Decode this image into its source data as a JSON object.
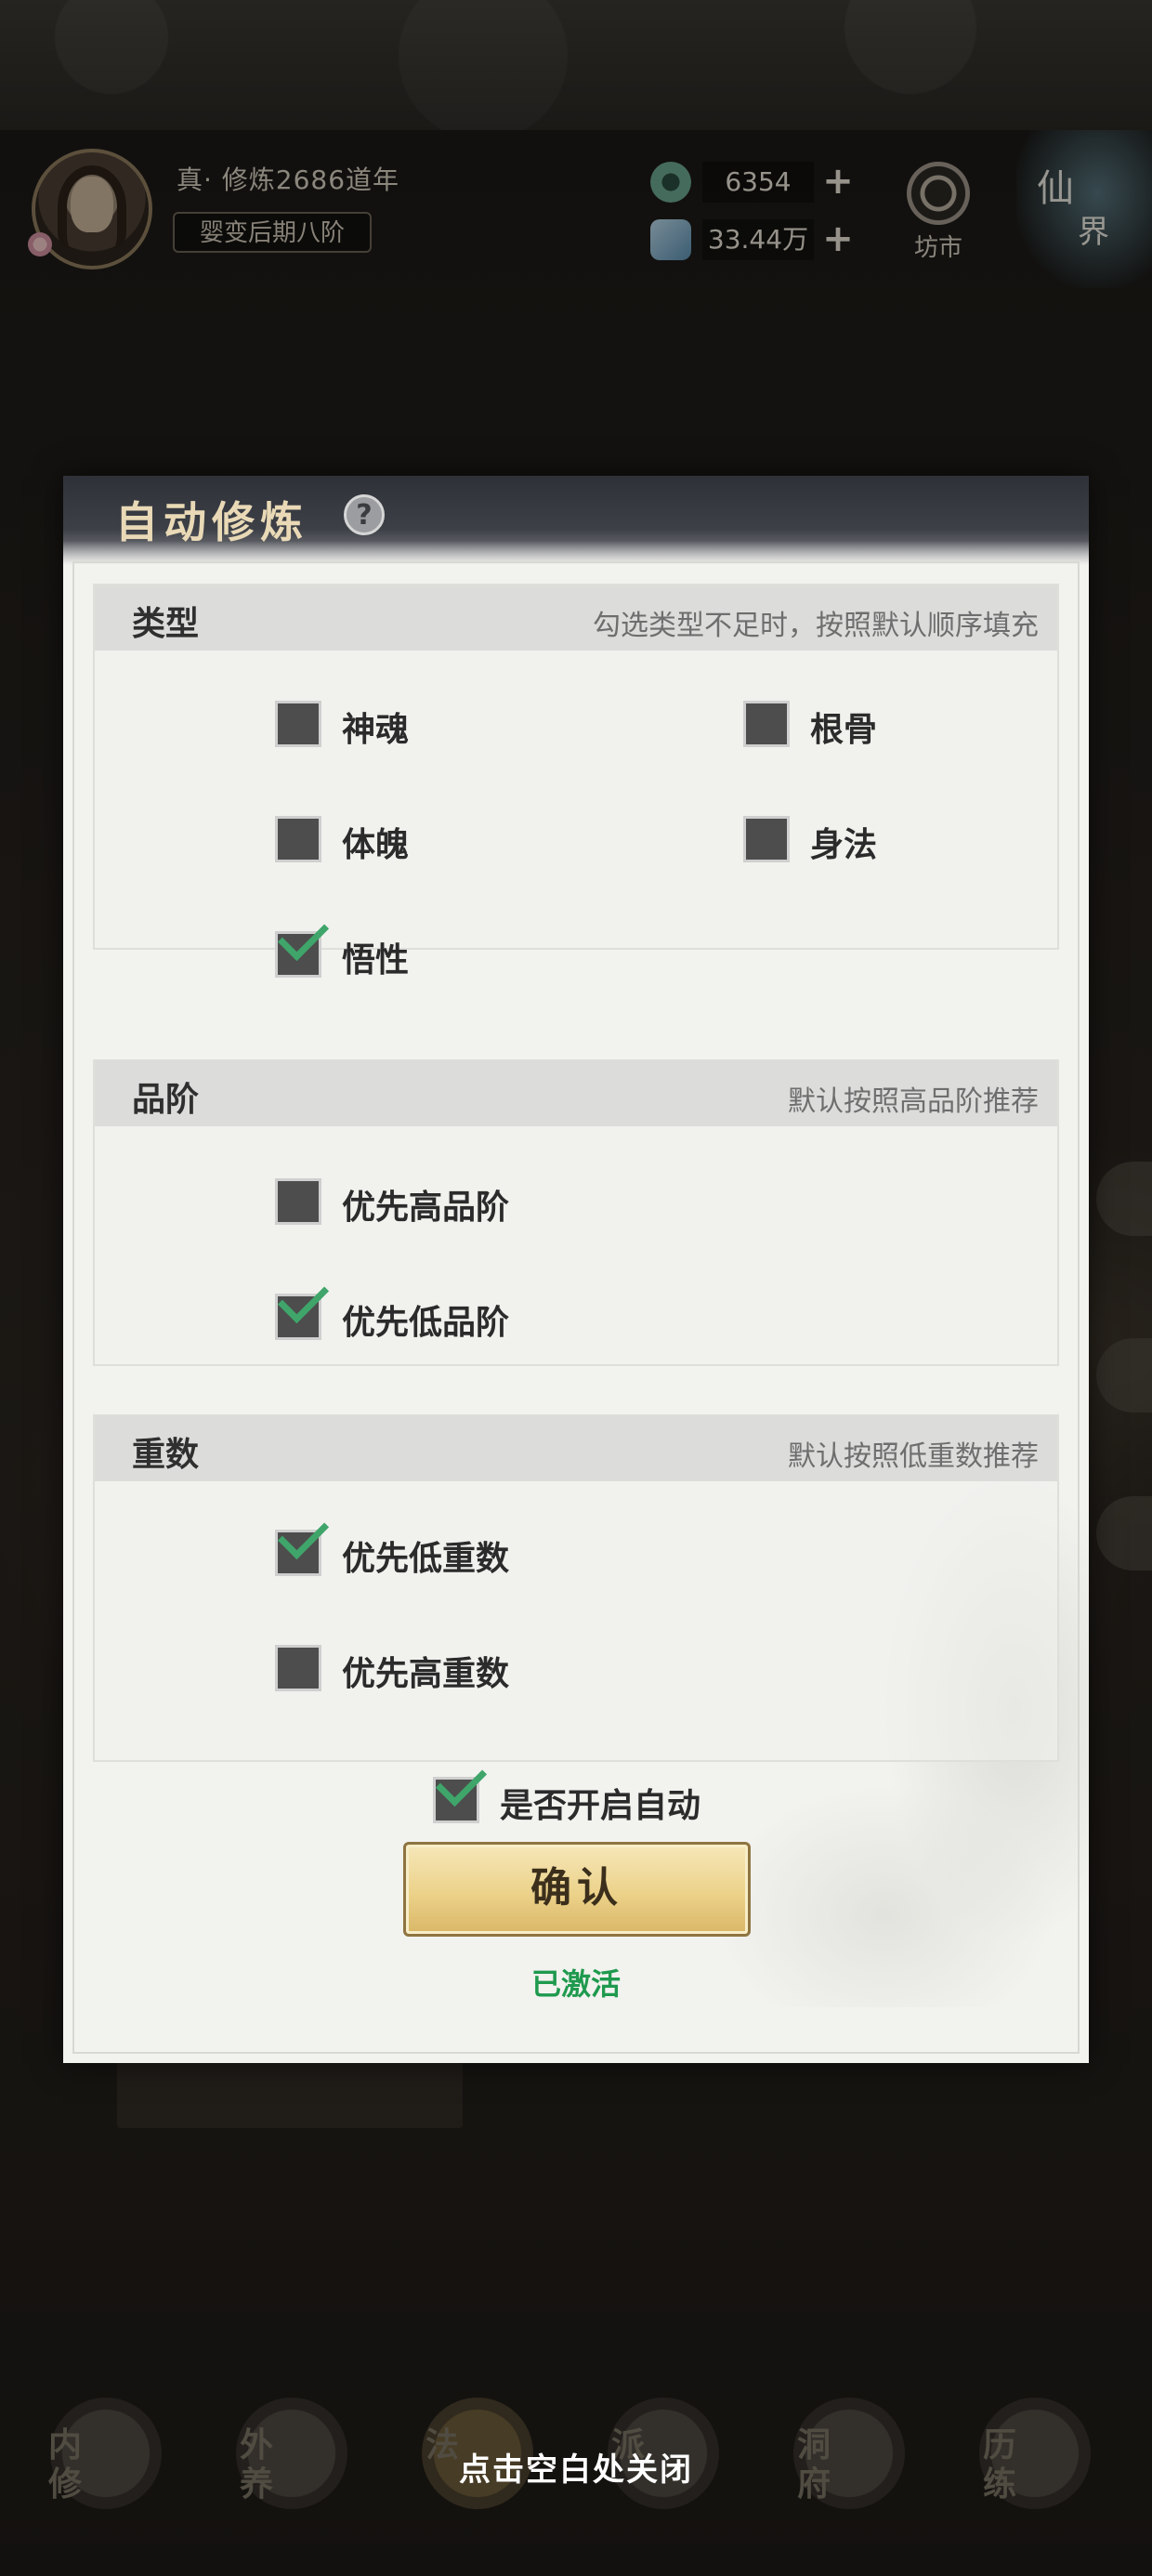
{
  "header": {
    "player_name": "真· 修炼2686道年",
    "realm": "婴变后期八阶",
    "currency": [
      {
        "icon": "jade-coin-icon",
        "value": "6354",
        "plus": "+"
      },
      {
        "icon": "spirit-stone-icon",
        "value": "33.44万",
        "plus": "+"
      }
    ],
    "market_label": "坊市",
    "realm_switch": {
      "line1": "仙",
      "line2": "界"
    }
  },
  "dialog": {
    "title": "自动修炼",
    "help": "?",
    "sections": [
      {
        "title": "类型",
        "hint": "勾选类型不足时，按照默认顺序填充",
        "options": [
          {
            "label": "神魂",
            "checked": false
          },
          {
            "label": "根骨",
            "checked": false
          },
          {
            "label": "体魄",
            "checked": false
          },
          {
            "label": "身法",
            "checked": false
          },
          {
            "label": "悟性",
            "checked": true
          }
        ]
      },
      {
        "title": "品阶",
        "hint": "默认按照高品阶推荐",
        "options": [
          {
            "label": "优先高品阶",
            "checked": false
          },
          {
            "label": "优先低品阶",
            "checked": true
          }
        ]
      },
      {
        "title": "重数",
        "hint": "默认按照低重数推荐",
        "options": [
          {
            "label": "优先低重数",
            "checked": true
          },
          {
            "label": "优先高重数",
            "checked": false
          }
        ]
      }
    ],
    "auto_toggle": {
      "label": "是否开启自动",
      "checked": true
    },
    "confirm_label": "确认",
    "status": "已激活"
  },
  "bottom_nav": [
    {
      "label_top": "内",
      "label_bottom": "修"
    },
    {
      "label_top": "外",
      "label_bottom": "养"
    },
    {
      "label_top": "",
      "label_bottom": "法"
    },
    {
      "label_top": "",
      "label_bottom": "派"
    },
    {
      "label_top": "洞",
      "label_bottom": "府"
    },
    {
      "label_top": "历",
      "label_bottom": "练"
    }
  ],
  "close_hint": "点击空白处关闭",
  "colors": {
    "accent_green": "#3fa56a",
    "status_green": "#1f9a4e",
    "button_gold": "#ecd28a"
  }
}
